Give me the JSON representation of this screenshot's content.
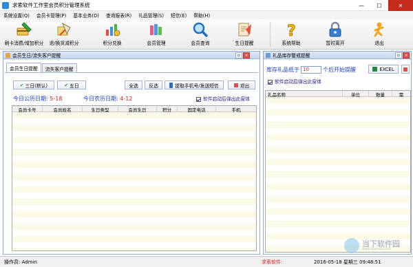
{
  "window": {
    "title": "求索软件工作室会员积分管理系统",
    "min": "—",
    "max": "☐",
    "close": "✕"
  },
  "menu": [
    "系统设置(Q)",
    "会员卡管理(P)",
    "基本业务(D)",
    "查询报表(R)",
    "礼品管理(S)",
    "短信(E)",
    "帮助(H)"
  ],
  "toolbar": [
    {
      "label": "刷卡消费/增加积分",
      "icon": "card-pen-icon"
    },
    {
      "label": "退/换货减积分",
      "icon": "return-goods-icon"
    },
    {
      "label": "积分兑换",
      "icon": "points-exchange-icon"
    },
    {
      "label": "会员管理",
      "icon": "members-icon"
    },
    {
      "label": "会员查询",
      "icon": "search-magnifier-icon"
    },
    {
      "label": "生日提醒",
      "icon": "birthday-icon"
    },
    {
      "label": "系统帮助",
      "icon": "help-icon"
    },
    {
      "label": "暂时离开",
      "icon": "lock-icon"
    },
    {
      "label": "退出",
      "icon": "exit-icon"
    }
  ],
  "left_panel": {
    "title": "会员生日/流失客户提醒",
    "tabs": [
      "会员生日提醒",
      "流失客户提醒"
    ],
    "buttons": {
      "three_days": "三日(默认)",
      "five_days": "五日",
      "select_all": "全选",
      "invert": "反选",
      "extract_sms": "提取手机号/发送短信",
      "exit": "退出"
    },
    "solar_label": "今日公历日期:",
    "solar_value": "5-18",
    "lunar_label": "今日农历日期:",
    "lunar_value": "4-12",
    "startup_popup": "软件启动后弹出此窗体",
    "columns": [
      "会员卡号",
      "会员姓名",
      "生日类型",
      "会员生日",
      "积分",
      "固定电话",
      "手机"
    ]
  },
  "right_panel": {
    "title": "礼品库存警戒提醒",
    "stock_prefix": "库存礼品低于",
    "stock_value": "10",
    "stock_suffix": "个后开始提醒",
    "excel_button": "EXCEL",
    "startup_popup": "软件启动后弹出此窗体",
    "columns": [
      "礼品名称",
      "单位",
      "数量",
      "需"
    ]
  },
  "status": {
    "operator": "操作员: Admin",
    "brand": "求索软件:",
    "datetime": "2016-05-18  星期三  09:48:51"
  },
  "watermark": {
    "text": "当下软件园",
    "sub": "www.downxia.com"
  }
}
